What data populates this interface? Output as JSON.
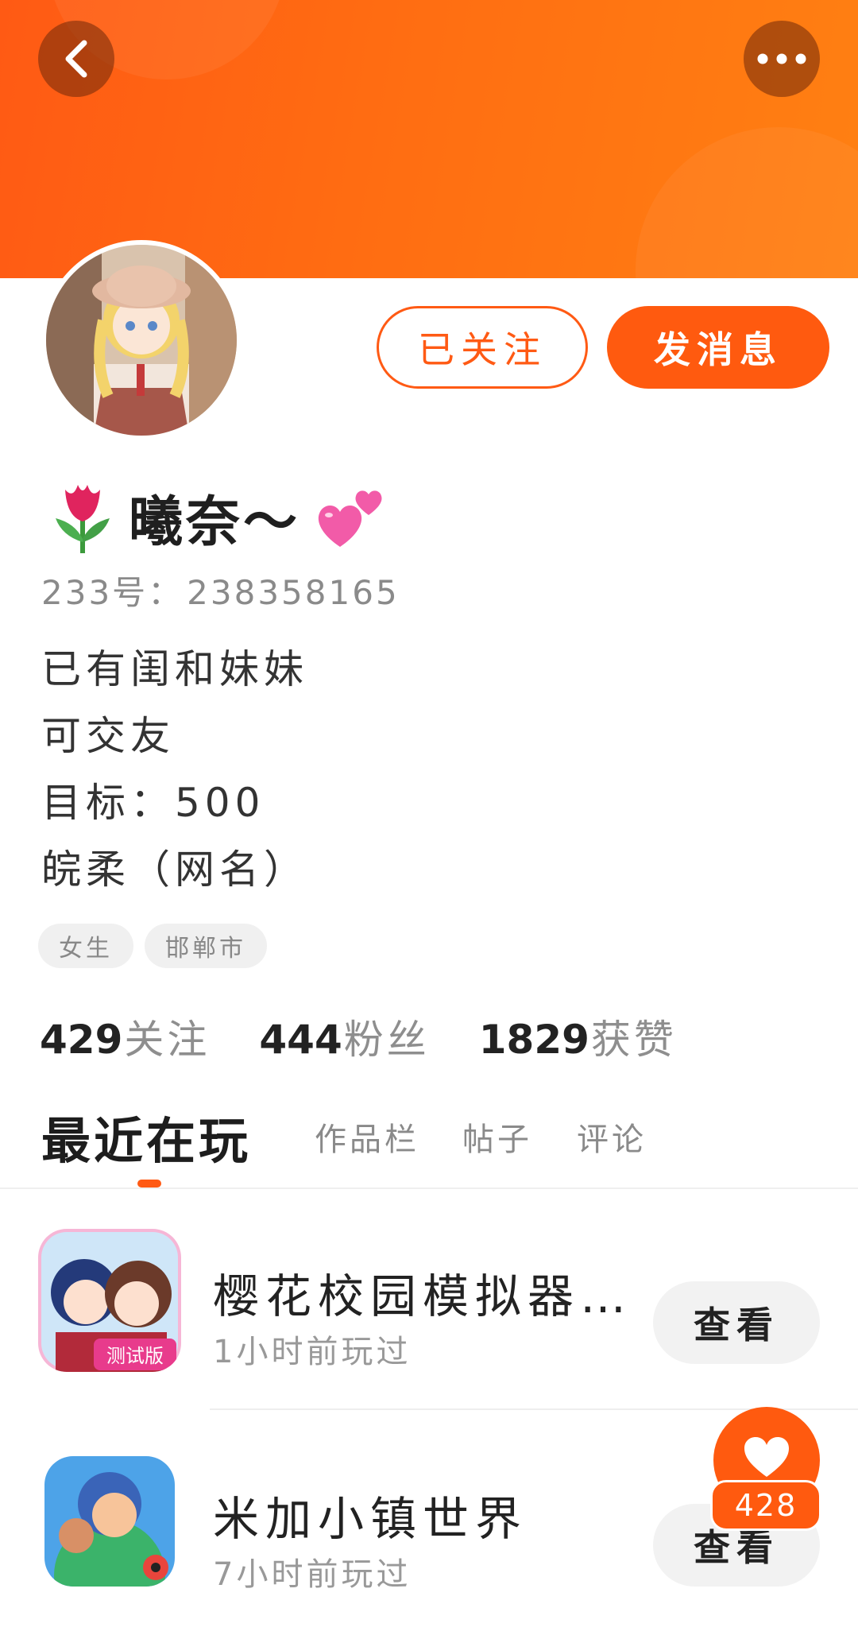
{
  "header": {
    "back_icon": "chevron-left-icon",
    "more_icon": "more-dots-icon",
    "accent_color": "#ff5a14"
  },
  "profile": {
    "follow_label": "已关注",
    "message_label": "发消息",
    "nickname": "曦奈～",
    "nickname_prefix_emoji": "tulip-emoji",
    "nickname_suffix_emoji": "two-hearts-emoji",
    "id_label": "233号：",
    "id_value": "238358165",
    "bio_lines": [
      "已有闺和妹妹",
      "可交友",
      "目标：500",
      "皖柔（网名）"
    ],
    "tags": [
      "女生",
      "邯郸市"
    ]
  },
  "stats": [
    {
      "value": "429",
      "label": "关注"
    },
    {
      "value": "444",
      "label": "粉丝"
    },
    {
      "value": "1829",
      "label": "获赞"
    }
  ],
  "tabs": [
    {
      "label": "最近在玩",
      "active": true
    },
    {
      "label": "作品栏",
      "active": false
    },
    {
      "label": "帖子",
      "active": false
    },
    {
      "label": "评论",
      "active": false
    }
  ],
  "games": [
    {
      "title": "樱花校园模拟器…",
      "time": "1小时前玩过",
      "button": "查看",
      "icon_badge": "测试版"
    },
    {
      "title": "米加小镇世界",
      "time": "7小时前玩过",
      "button": "查看"
    }
  ],
  "like_fab": {
    "icon": "heart-icon",
    "count": "428"
  }
}
